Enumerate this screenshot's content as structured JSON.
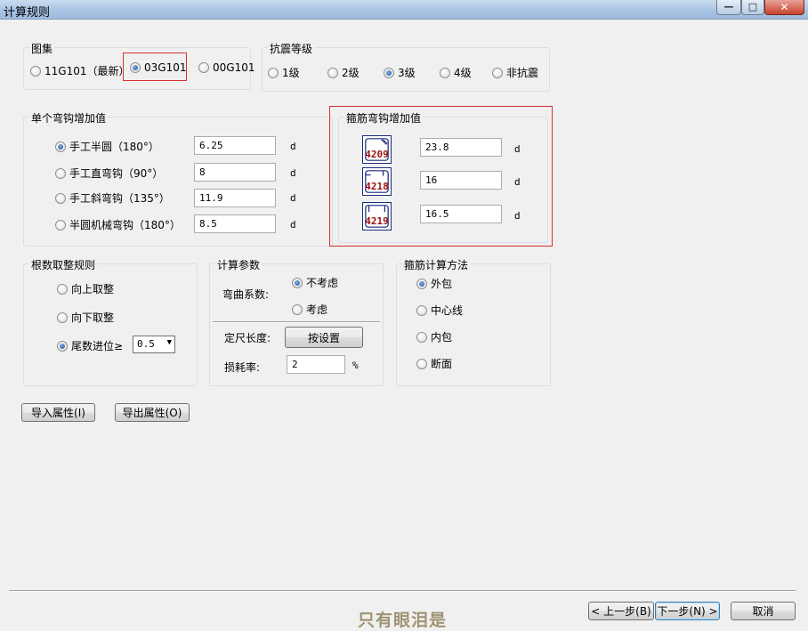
{
  "window": {
    "title": "计算规则",
    "min_glyph": "—",
    "max_glyph": "□",
    "close_glyph": "✕"
  },
  "atlas": {
    "legend": "图集",
    "options": [
      {
        "label": "11G101（最新）",
        "checked": false
      },
      {
        "label": "03G101",
        "checked": true
      },
      {
        "label": "00G101",
        "checked": false
      }
    ]
  },
  "seismic": {
    "legend": "抗震等级",
    "options": [
      {
        "label": "1级",
        "checked": false
      },
      {
        "label": "2级",
        "checked": false
      },
      {
        "label": "3级",
        "checked": true
      },
      {
        "label": "4级",
        "checked": false
      },
      {
        "label": "非抗震",
        "checked": false
      }
    ]
  },
  "hook": {
    "legend": "单个弯钩增加值",
    "rows": [
      {
        "label": "手工半圆（180°）",
        "value": "6.25",
        "unit": "d",
        "checked": true
      },
      {
        "label": "手工直弯钩（90°）",
        "value": "8",
        "unit": "d",
        "checked": false
      },
      {
        "label": "手工斜弯钩（135°）",
        "value": "11.9",
        "unit": "d",
        "checked": false
      },
      {
        "label": "半圆机械弯钩（180°）",
        "value": "8.5",
        "unit": "d",
        "checked": false
      }
    ]
  },
  "stirrup_hook": {
    "legend": "箍筋弯钩增加值",
    "rows": [
      {
        "code": "4209",
        "value": "23.8",
        "unit": "d"
      },
      {
        "code": "4218",
        "value": "16",
        "unit": "d"
      },
      {
        "code": "4219",
        "value": "16.5",
        "unit": "d"
      }
    ]
  },
  "rounding": {
    "legend": "根数取整规则",
    "options": [
      {
        "label": "向上取整",
        "checked": false
      },
      {
        "label": "向下取整",
        "checked": false
      },
      {
        "label": "尾数进位≥",
        "checked": true
      }
    ],
    "threshold": "0.5"
  },
  "calc_params": {
    "legend": "计算参数",
    "bend_label": "弯曲系数:",
    "bend_options": [
      {
        "label": "不考虑",
        "checked": true
      },
      {
        "label": "考虑",
        "checked": false
      }
    ],
    "fixed_length_label": "定尺长度:",
    "fixed_length_button": "按设置",
    "loss_label": "损耗率:",
    "loss_value": "2",
    "loss_unit": "%"
  },
  "stirrup_method": {
    "legend": "箍筋计算方法",
    "options": [
      {
        "label": "外包",
        "checked": true
      },
      {
        "label": "中心线",
        "checked": false
      },
      {
        "label": "内包",
        "checked": false
      },
      {
        "label": "断面",
        "checked": false
      }
    ]
  },
  "actions": {
    "import": "导入属性(I)",
    "export": "导出属性(O)",
    "prev": "< 上一步(B)",
    "next": "下一步(N) >",
    "cancel": "取消"
  },
  "watermark": "只有眼泪是"
}
